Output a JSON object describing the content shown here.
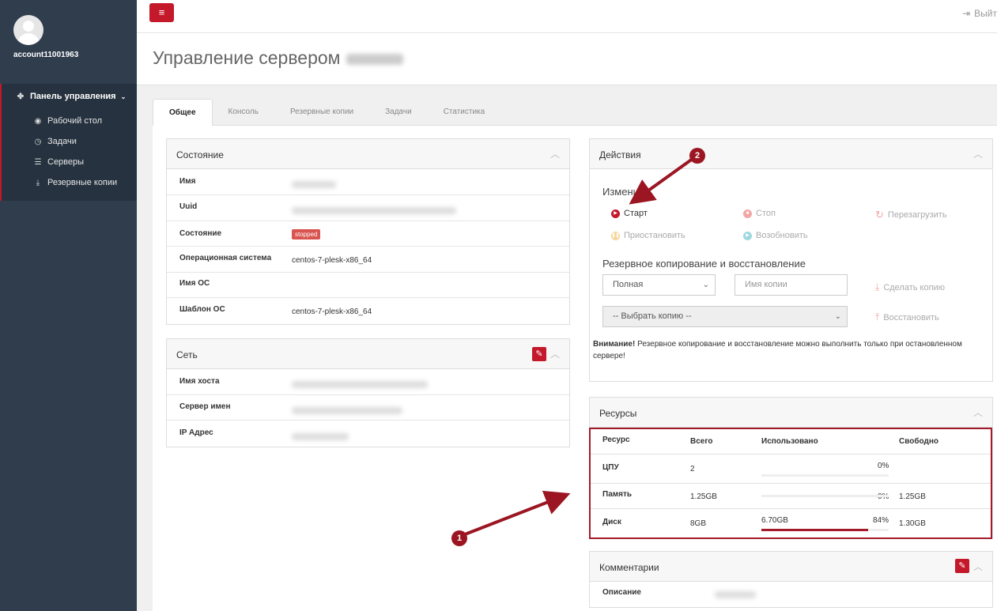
{
  "sidebar": {
    "account": "account11001963",
    "nav_header": "Панель управления",
    "items": [
      {
        "label": "Рабочий стол",
        "icon": "dashboard-icon"
      },
      {
        "label": "Задачи",
        "icon": "clock-icon"
      },
      {
        "label": "Серверы",
        "icon": "list-icon"
      },
      {
        "label": "Резервные копии",
        "icon": "download-icon"
      }
    ]
  },
  "topbar": {
    "menu_icon": "≡",
    "logout": "Выйт"
  },
  "page": {
    "title": "Управление сервером"
  },
  "tabs": [
    {
      "label": "Общее",
      "active": true
    },
    {
      "label": "Консоль"
    },
    {
      "label": "Резервные копии"
    },
    {
      "label": "Задачи"
    },
    {
      "label": "Статистика"
    }
  ],
  "state_panel": {
    "title": "Состояние",
    "rows": [
      {
        "label": "Имя",
        "value": ""
      },
      {
        "label": "Uuid",
        "value": ""
      },
      {
        "label": "Состояние",
        "badge": "stopped"
      },
      {
        "label": "Операционная система",
        "value": "centos-7-plesk-x86_64"
      },
      {
        "label": "Имя ОС",
        "value": ""
      },
      {
        "label": "Шаблон ОС",
        "value": "centos-7-plesk-x86_64"
      }
    ]
  },
  "network_panel": {
    "title": "Сеть",
    "rows": [
      {
        "label": "Имя хоста"
      },
      {
        "label": "Сервер имен"
      },
      {
        "label": "IP Адрес"
      }
    ]
  },
  "actions_panel": {
    "title": "Действия",
    "change_heading": "Изменить",
    "start": "Старт",
    "stop": "Стоп",
    "restart": "Перезагрузить",
    "pause": "Приостановить",
    "resume": "Возобновить",
    "backup_heading": "Резервное копирование и восстановление",
    "backup_type": "Полная",
    "backup_name_placeholder": "Имя копии",
    "make_backup": "Сделать копию",
    "select_backup": "-- Выбрать копию --",
    "restore": "Восстановить",
    "warning_bold": "Внимание!",
    "warning_text": " Резервное копирование и восстановление можно выполнить только при остановленном сервере!"
  },
  "resources_panel": {
    "title": "Ресурсы",
    "headers": [
      "Ресурс",
      "Всего",
      "Использовано",
      "Свободно"
    ],
    "rows": [
      {
        "name": "ЦПУ",
        "total": "2",
        "used": "",
        "pct": "0%",
        "pct_value": 0,
        "free": ""
      },
      {
        "name": "Память",
        "total": "1.25GB",
        "used": "",
        "pct": "0%",
        "pct_value": 0,
        "free": "1.25GB"
      },
      {
        "name": "Диск",
        "total": "8GB",
        "used": "6.70GB",
        "pct": "84%",
        "pct_value": 84,
        "free": "1.30GB"
      }
    ]
  },
  "comments_panel": {
    "title": "Комментарии",
    "description_label": "Описание"
  },
  "annotations": {
    "marker1": "1",
    "marker2": "2"
  },
  "colors": {
    "accent": "#c4182b",
    "sidebar": "#2f3d4d",
    "annotation": "#9b1622"
  }
}
